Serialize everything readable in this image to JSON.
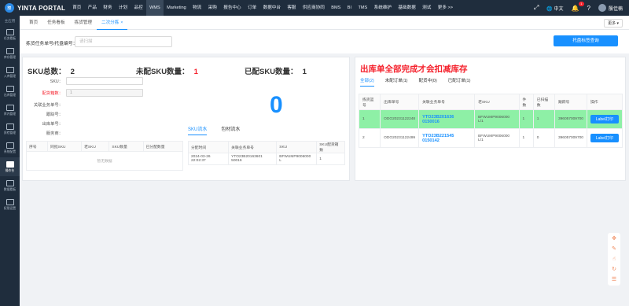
{
  "app": {
    "logo_text": "YINTA PORTAL"
  },
  "nav": [
    "首页",
    "产品",
    "财务",
    "计划",
    "品控",
    "WMS",
    "Marketing",
    "物流",
    "采购",
    "报告中心",
    "订单",
    "数据中台",
    "客服",
    "供应商协同",
    "BMS",
    "BI",
    "TMS",
    "系统维护",
    "基础数据",
    "测试",
    "更多 >>"
  ],
  "nav_active_index": 5,
  "top_right": {
    "lang": "中文",
    "badge": "1",
    "user": "殷佳楠"
  },
  "sidebar": {
    "top_label": "主应用",
    "items": [
      "任务看板",
      "库存管理",
      "入库管理",
      "出库管理",
      "库内管理",
      "质检管理",
      "系统配置",
      "操作台",
      "数据看板",
      "权限设置"
    ],
    "active_index": 7
  },
  "tabs": [
    {
      "label": "首页"
    },
    {
      "label": "任务看板"
    },
    {
      "label": "拣货管理"
    },
    {
      "label": "二次分拣",
      "active": true,
      "close": "×"
    }
  ],
  "more": "更多 ▾",
  "search": {
    "label": "拣货任务单号/托盘编号：",
    "placeholder": "请扫描",
    "button": "托盘标签查询"
  },
  "stats": {
    "total_label": "SKU总数：",
    "total_value": "2",
    "unmatched_label": "未配SKU数量：",
    "unmatched_value": "1",
    "matched_label": "已配SKU数量：",
    "matched_value": "1"
  },
  "form": {
    "sku_label": "SKU：",
    "qty_label": "配货箱数：",
    "qty_value": "1",
    "biz_label": "关联业务单号：",
    "track_label": "跟踪号：",
    "out_label": "出库单号：",
    "service_label": "服务商："
  },
  "big_number": "0",
  "left_table": {
    "headers": [
      "序号",
      "同批SKU",
      "老SKU",
      "SKU数量",
      "已分配数量"
    ],
    "empty_text": "暂无数据"
  },
  "sub_tabs": [
    "SKU流水",
    "包材流水"
  ],
  "flow_table": {
    "headers": [
      "分配时间",
      "关联业务单号",
      "SKU",
      "SKU配货箱数"
    ],
    "row": {
      "time": "2024-03-26 22:02:37",
      "biz": "YTO23B20163601 50016",
      "sku": "BFWUMP9006000 L",
      "boxes": "1"
    }
  },
  "right": {
    "title": "出库单全部完成才会扣减库存",
    "tabs": [
      "全部(2)",
      "未配订单(1)",
      "配货中(0)",
      "已配订单(1)"
    ],
    "headers": [
      "拣货篮号",
      "出库单号",
      "关联业务单号",
      "老SKU",
      "件数",
      "已扫描数",
      "跟踪号",
      "操作"
    ],
    "rows": [
      {
        "basket": "1",
        "out": "ODO20231122248",
        "biz": "YTO23B201636 0150016",
        "sku": "BFWUMP9006000 L/1",
        "qty": "1",
        "scanned": "1",
        "track": "396057009700",
        "op": "Label打印"
      },
      {
        "basket": "2",
        "out": "ODO20231122499",
        "biz": "YTO23B221545 0150142",
        "sku": "BFWUMP9006000 L/1",
        "qty": "1",
        "scanned": "0",
        "track": "396057009700",
        "op": "Label打印"
      }
    ]
  },
  "colors": {
    "accent": "#1890ff",
    "danger": "#f5222d",
    "highlight_row": "#8ef0a6",
    "topbar": "#1f2d3d"
  }
}
